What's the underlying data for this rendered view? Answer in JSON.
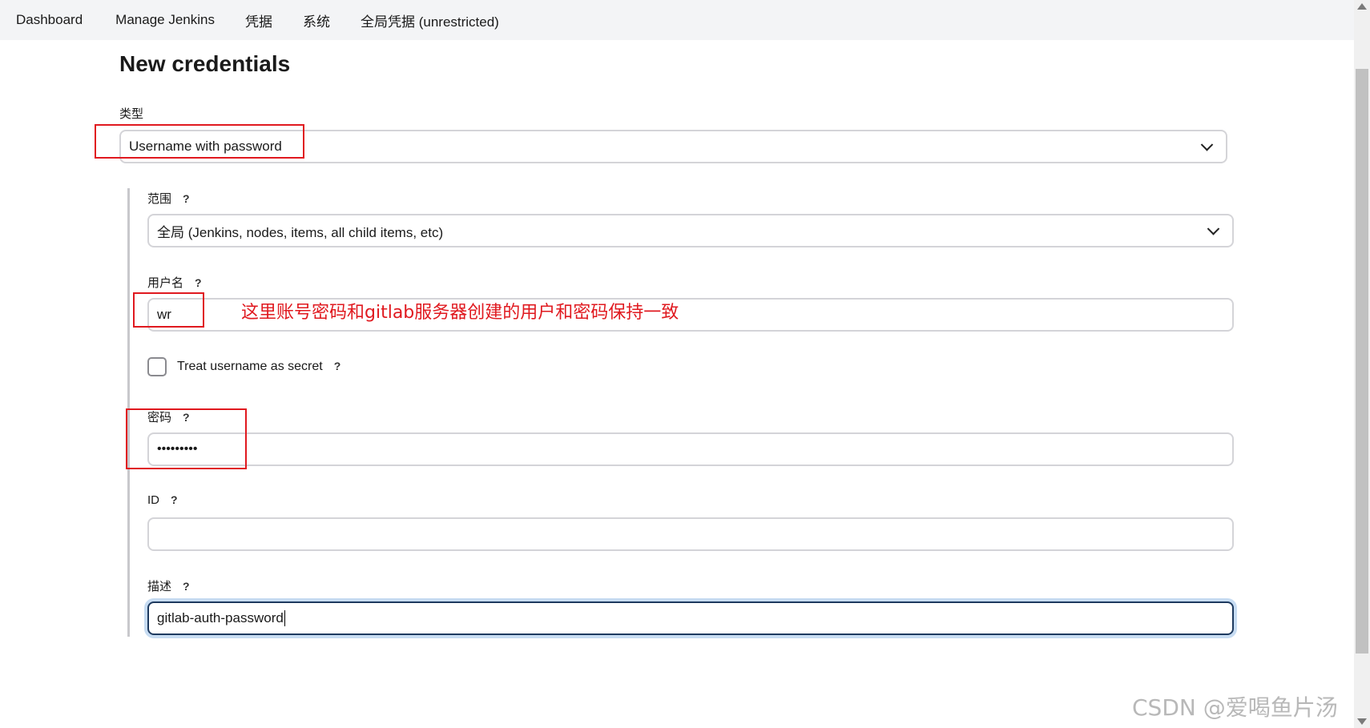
{
  "breadcrumbs": [
    "Dashboard",
    "Manage Jenkins",
    "凭据",
    "系统",
    "全局凭据 (unrestricted)"
  ],
  "page_title": "New credentials",
  "form": {
    "kind": {
      "label": "类型",
      "value": "Username with password"
    },
    "scope": {
      "label": "范围",
      "help": "?",
      "value": "全局 (Jenkins, nodes, items, all child items, etc)"
    },
    "username": {
      "label": "用户名",
      "help": "?",
      "value": "wr"
    },
    "username_secret": {
      "label": "Treat username as secret",
      "help": "?",
      "checked": false
    },
    "password": {
      "label": "密码",
      "help": "?",
      "value": "•••••••••"
    },
    "id": {
      "label": "ID",
      "help": "?",
      "value": ""
    },
    "description": {
      "label": "描述",
      "help": "?",
      "value": "gitlab-auth-password"
    }
  },
  "annotation_text": "这里账号密码和gitlab服务器创建的用户和密码保持一致",
  "watermark": "CSDN @爱喝鱼片汤",
  "colors": {
    "annotation": "#e0191f",
    "topbar_bg": "#f3f4f6",
    "focus_ring": "#c7dcf2"
  }
}
